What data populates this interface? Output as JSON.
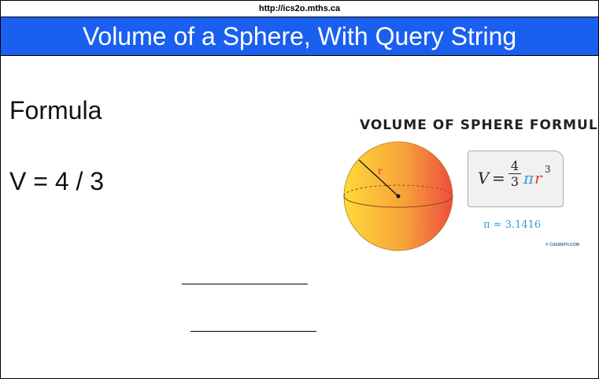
{
  "browser": {
    "url": "http://ics2o.mths.ca"
  },
  "header": {
    "title": "Volume of a Sphere, With Query String"
  },
  "main": {
    "heading": "Formula",
    "equation": "V = 4 / 3"
  },
  "diagram": {
    "title": "VOLUME OF SPHERE FORMULA",
    "radius_label": "r",
    "formula": {
      "lhs": "V",
      "equals": "=",
      "numerator": "4",
      "denominator": "3",
      "pi": "π",
      "r": "r",
      "exponent": "3"
    },
    "pi_approx": "π ≈ 3.1416",
    "credit": "© CUEMATH.COM",
    "colors": {
      "sphere_light": "#ffd93a",
      "sphere_dark": "#ef4d3d",
      "pi": "#2b9fd9",
      "radius": "#e53b3b"
    }
  },
  "colors": {
    "title_bar": "#1a5ff0"
  }
}
